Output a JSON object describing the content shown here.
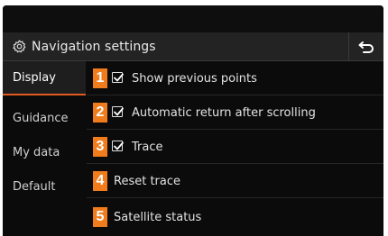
{
  "header": {
    "title": "Navigation settings",
    "icon": "gear-icon",
    "back_icon": "back-arrow-icon"
  },
  "sidebar": {
    "items": [
      {
        "label": "Display",
        "active": true
      },
      {
        "label": "Guidance",
        "active": false
      },
      {
        "label": "My data",
        "active": false
      },
      {
        "label": "Default",
        "active": false
      }
    ]
  },
  "options": [
    {
      "number": "1",
      "label": "Show previous points",
      "checked": true
    },
    {
      "number": "2",
      "label": "Automatic return after scrolling",
      "checked": true
    },
    {
      "number": "3",
      "label": "Trace",
      "checked": true
    },
    {
      "number": "4",
      "label": "Reset trace",
      "checked": null
    },
    {
      "number": "5",
      "label": "Satellite status",
      "checked": null
    }
  ],
  "colors": {
    "accent": "#e15b1f",
    "number_badge": "#f07c1b",
    "background": "#0b0b0b",
    "header": "#232323"
  }
}
